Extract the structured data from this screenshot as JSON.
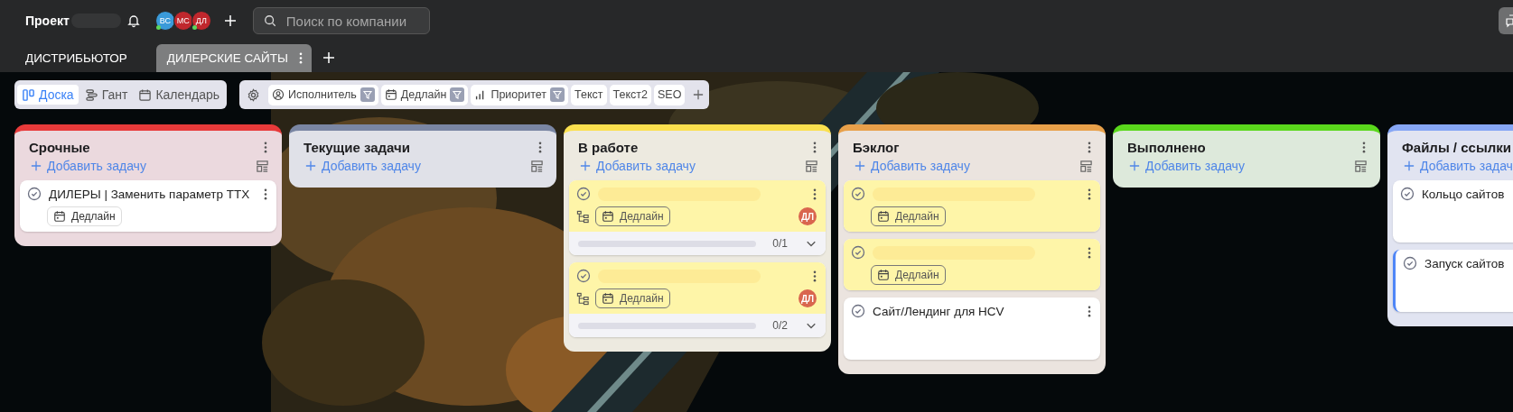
{
  "header": {
    "project_label": "Проект",
    "members": [
      {
        "initials": "ВС",
        "color": "#3a9ad9",
        "online": true
      },
      {
        "initials": "МС",
        "color": "#c0272d",
        "online": false
      },
      {
        "initials": "ДЛ",
        "color": "#c0272d",
        "online": true
      }
    ],
    "search": {
      "placeholder": "Поиск по компании"
    }
  },
  "tabs": [
    {
      "label": "ДИСТРИБЬЮТОР",
      "selected": false
    },
    {
      "label": "ДИЛЕРСКИЕ САЙТЫ",
      "selected": true
    }
  ],
  "views": [
    {
      "label": "Доска",
      "kind": "board",
      "selected": true
    },
    {
      "label": "Гант",
      "kind": "gantt",
      "selected": false
    },
    {
      "label": "Календарь",
      "kind": "calendar",
      "selected": false
    }
  ],
  "fields": [
    {
      "label": "Исполнитель",
      "kind": "person",
      "filter": true
    },
    {
      "label": "Дедлайн",
      "kind": "date",
      "filter": true
    },
    {
      "label": "Приоритет",
      "kind": "priority",
      "filter": true
    },
    {
      "label": "Текст",
      "kind": "text",
      "filter": false
    },
    {
      "label": "Текст2",
      "kind": "text",
      "filter": false
    },
    {
      "label": "SEO",
      "kind": "text",
      "filter": false
    }
  ],
  "columns": [
    {
      "title": "Срочные",
      "color": "#e83a3a",
      "add_label": "Добавить задачу",
      "tasks": [
        {
          "title": "ДИЛЕРЫ | Заменить параметр ТТХ",
          "redacted": false,
          "highlighted": false,
          "accent": false,
          "deadline": "Дедлайн"
        }
      ]
    },
    {
      "title": "Текущие задачи",
      "color": "#7a86a3",
      "add_label": "Добавить задачу"
    },
    {
      "title": "В работе",
      "color": "#fbe04e",
      "add_label": "Добавить задачу",
      "tasks": [
        {
          "redacted": true,
          "highlighted": true,
          "accent": false,
          "deadline": "Дедлайн",
          "assignee": "ДЛ",
          "subtasks": {
            "count": "0/1"
          }
        },
        {
          "redacted": true,
          "highlighted": true,
          "accent": false,
          "deadline": "Дедлайн",
          "assignee": "ДЛ",
          "subtasks": {
            "count": "0/2"
          }
        }
      ]
    },
    {
      "title": "Бэклог",
      "color": "#e8a04a",
      "add_label": "Добавить задачу",
      "tasks": [
        {
          "redacted": true,
          "highlighted": true,
          "accent": false,
          "deadline": "Дедлайн"
        },
        {
          "redacted": true,
          "highlighted": true,
          "accent": false,
          "deadline": "Дедлайн"
        },
        {
          "title": "Сайт/Лендинг для HCV",
          "redacted": false,
          "highlighted": false,
          "accent": false
        }
      ]
    },
    {
      "title": "Выполнено",
      "color": "#5ad81c",
      "add_label": "Добавить задачу"
    },
    {
      "title": "Файлы / ссылки",
      "color": "#86a6f5",
      "add_label": "Добавить задач",
      "tasks": [
        {
          "title": "Кольцо сайтов",
          "redacted": false,
          "highlighted": false,
          "accent": false
        },
        {
          "title": "Запуск сайтов",
          "redacted": false,
          "highlighted": false,
          "accent": true
        }
      ]
    }
  ]
}
